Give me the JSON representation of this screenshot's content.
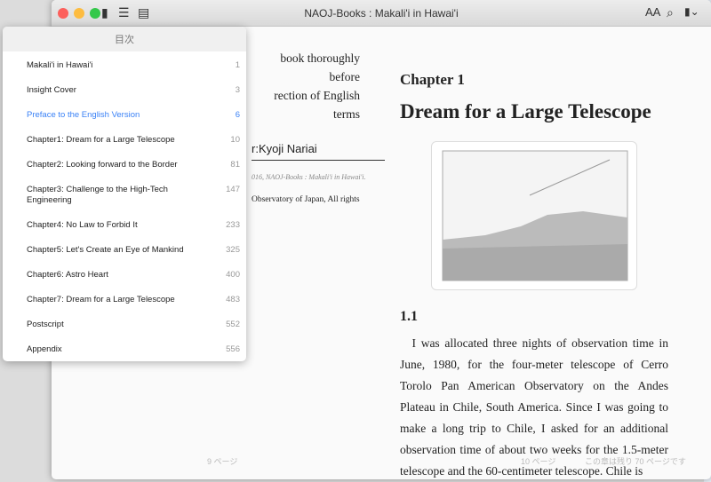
{
  "window": {
    "title": "NAOJ-Books : Makali'i in Hawai'i"
  },
  "toolbar": {
    "font_size_icon": "AA",
    "search_icon": "search-icon",
    "bookmark_icon": "bookmark-icon"
  },
  "left_page": {
    "lines": [
      "book thoroughly before",
      "rection of English terms"
    ],
    "author": "r:Kyoji Nariai",
    "copyright": "016, NAOJ-Books : Makali'i in Hawai'i.",
    "rights": "Observatory of Japan, All rights",
    "footer": "9 ページ"
  },
  "right_page": {
    "chapter_label": "Chapter 1",
    "chapter_title": "Dream for a Large Telescope",
    "section": "1.1",
    "body": "I was allocated three nights of observation time in June, 1980, for the four-meter telescope of Cerro Torolo Pan American Observatory on the Andes Plateau in Chile, South America. Since I was going to make a long trip to Chile, I asked for an additional observation time of about two weeks for the 1.5-meter telescope and the 60-centimeter telescope. Chile is",
    "footer": "10 ページ",
    "remaining": "この章は残り 70 ページです"
  },
  "toc": {
    "header": "目次",
    "items": [
      {
        "label": "Makali'i in Hawai'i",
        "page": "1"
      },
      {
        "label": "Insight Cover",
        "page": "3"
      },
      {
        "label": "Preface to the English Version",
        "page": "6",
        "active": true
      },
      {
        "label": "Chapter1: Dream for a Large Telescope",
        "page": "10"
      },
      {
        "label": "Chapter2: Looking forward to the Border",
        "page": "81"
      },
      {
        "label": "Chapter3: Challenge to the High-Tech Engineering",
        "page": "147"
      },
      {
        "label": "Chapter4: No Law to Forbid It",
        "page": "233"
      },
      {
        "label": "Chapter5: Let's Create an Eye of Mankind",
        "page": "325"
      },
      {
        "label": "Chapter6: Astro Heart",
        "page": "400"
      },
      {
        "label": "Chapter7: Dream for a Large Telescope",
        "page": "483"
      },
      {
        "label": "Postscript",
        "page": "552"
      },
      {
        "label": "Appendix",
        "page": "556"
      }
    ]
  }
}
